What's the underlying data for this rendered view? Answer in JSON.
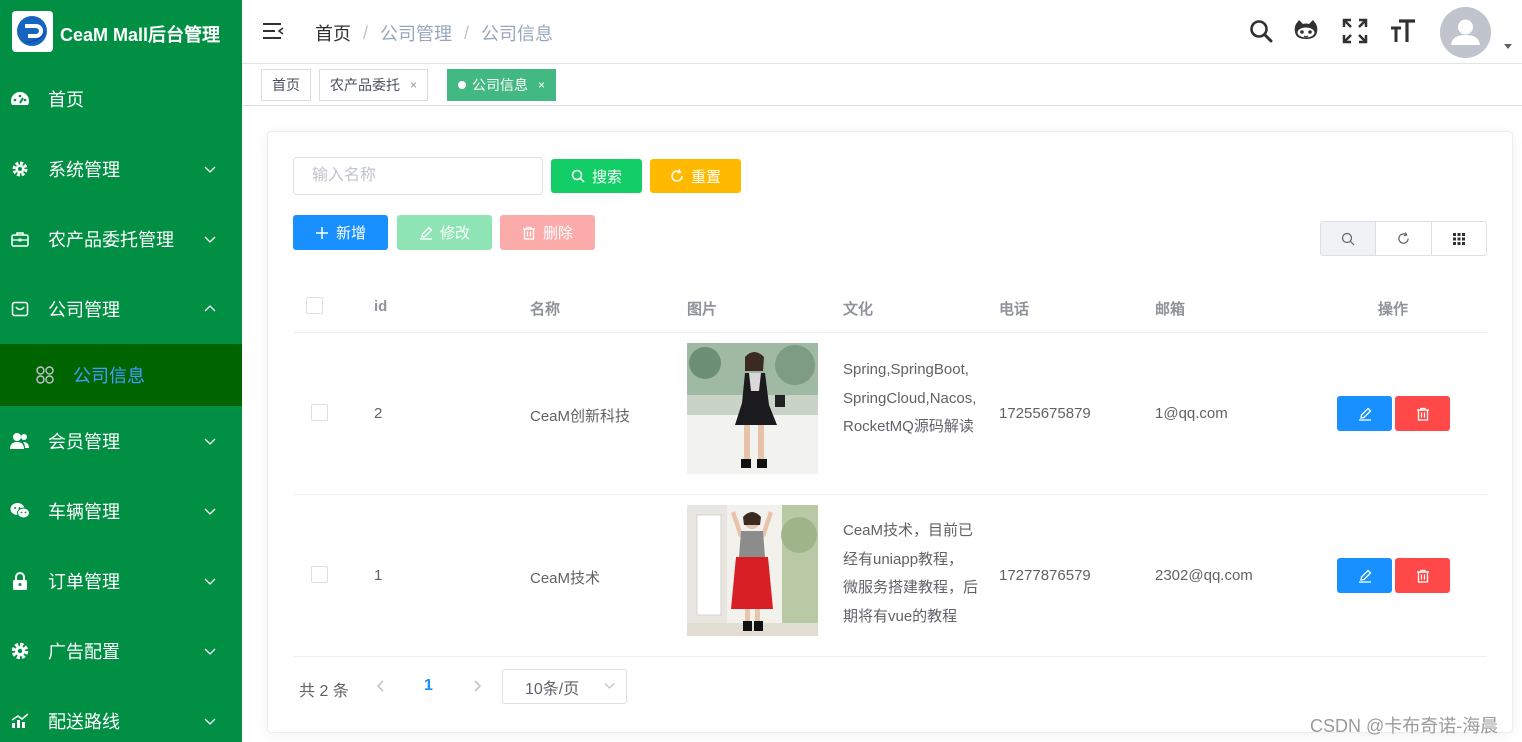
{
  "sidebar": {
    "logo_title": "CeaM Mall后台管理",
    "items": [
      {
        "label": "首页",
        "icon": "dashboard-icon",
        "has_arrow": false
      },
      {
        "label": "系统管理",
        "icon": "gear-icon",
        "has_arrow": true
      },
      {
        "label": "农产品委托管理",
        "icon": "toolbox-icon",
        "has_arrow": true
      },
      {
        "label": "公司管理",
        "icon": "shop-icon",
        "has_arrow": true,
        "expanded": true
      },
      {
        "label": "会员管理",
        "icon": "user-group-icon",
        "has_arrow": true
      },
      {
        "label": "车辆管理",
        "icon": "wechat-icon",
        "has_arrow": true
      },
      {
        "label": "订单管理",
        "icon": "lock-icon",
        "has_arrow": true
      },
      {
        "label": "广告配置",
        "icon": "settings-icon",
        "has_arrow": true
      },
      {
        "label": "配送路线",
        "icon": "chart-icon",
        "has_arrow": true
      }
    ],
    "subitem": {
      "label": "公司信息",
      "icon": "grid-icon"
    },
    "colors": {
      "bg": "#008f43",
      "active_bg": "#006400",
      "active_text": "#409eff"
    }
  },
  "header": {
    "breadcrumb": [
      "首页",
      "公司管理",
      "公司信息"
    ],
    "separator": "/",
    "icons": [
      "search-icon",
      "github-icon",
      "fullscreen-icon",
      "font-size-icon"
    ]
  },
  "tags": [
    {
      "label": "首页",
      "closable": false,
      "active": false
    },
    {
      "label": "农产品委托",
      "closable": true,
      "active": false
    },
    {
      "label": "公司信息",
      "closable": true,
      "active": true
    }
  ],
  "toolbar": {
    "search_placeholder": "输入名称",
    "search_label": "搜索",
    "reset_label": "重置",
    "add_label": "新增",
    "edit_label": "修改",
    "delete_label": "删除"
  },
  "table": {
    "headers": [
      "id",
      "名称",
      "图片",
      "文化",
      "电话",
      "邮箱",
      "操作"
    ],
    "rows": [
      {
        "id": "2",
        "name": "CeaM创新科技",
        "culture": "Spring,SpringBoot,SpringCloud,Nacos,RocketMQ源码解读",
        "phone": "17255675879",
        "email": "1@qq.com"
      },
      {
        "id": "1",
        "name": "CeaM技术",
        "culture": "CeaM技术，目前已经有uniapp教程，微服务搭建教程，后期将有vue的教程",
        "phone": "17277876579",
        "email": "2302@qq.com"
      }
    ]
  },
  "pagination": {
    "total_text": "共 2 条",
    "current_page": "1",
    "page_size": "10条/页"
  },
  "watermark": "CSDN @卡布奇诺-海晨",
  "colors": {
    "search": "#13ce66",
    "reset": "#ffba00",
    "add": "#1890ff",
    "edit_disabled": "#8ee4b5",
    "delete_disabled": "#fcabab",
    "op_edit": "#1890ff",
    "op_delete": "#ff4949",
    "tag_active": "#42b983"
  }
}
